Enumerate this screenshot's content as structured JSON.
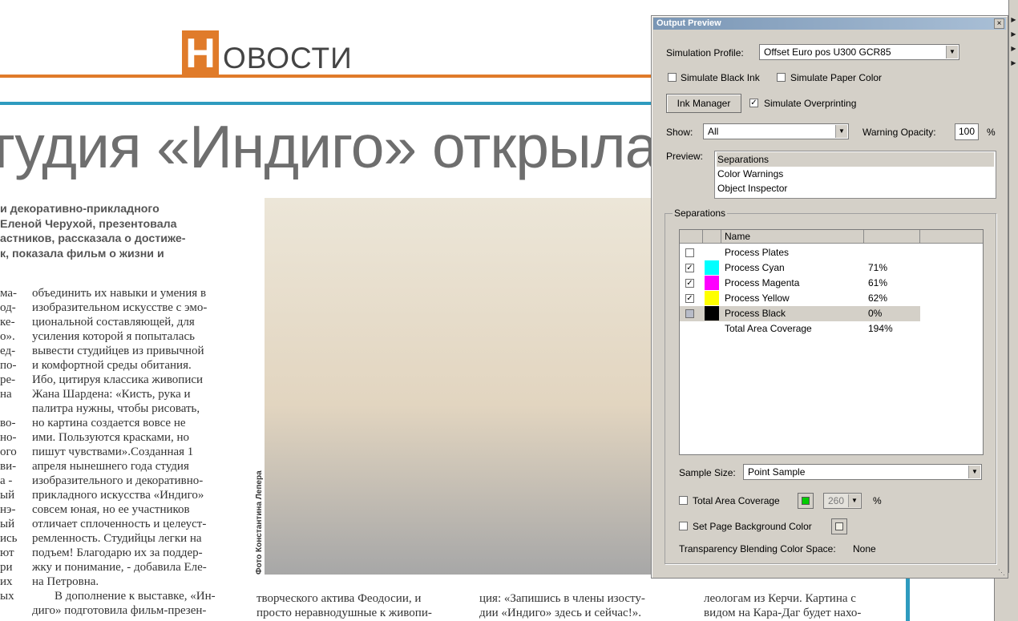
{
  "newspaper": {
    "heading_letter": "Н",
    "heading_rest": "ОВОСТИ",
    "headline": "тудия «Индиго» открыла в",
    "lead_lines": [
      "и декоративно-прикладного",
      "Еленой Черухой, презентовала",
      "астников, рассказала о достиже-",
      "к, показала фильм о жизни и"
    ],
    "col_a_lines": [
      "ма-",
      "од-",
      "ке-",
      "о».",
      "ед-",
      "по-",
      "ре-",
      "на",
      "",
      "во-",
      "но-",
      "ого",
      "ви-",
      "а -",
      "ый",
      "нэ-",
      "ый",
      "ись",
      "ют",
      "ри",
      "их",
      "ых"
    ],
    "col_b_lines": [
      "объединить их навыки и умения в",
      "изобразительном искусстве с эмо-",
      "циональной составляющей, для",
      "усиления которой я попыталась",
      "вывести студийцев из привычной",
      "и комфортной среды обитания.",
      "Ибо, цитируя классика живописи",
      "Жана Шардена: «Кисть, рука и",
      "палитра нужны, чтобы рисовать,",
      "но картина создается вовсе не",
      "ими. Пользуются красками, но",
      "пишут чувствами».Созданная 1",
      "апреля нынешнего года студия",
      "изобразительного и декоративно-",
      "прикладного искусства «Индиго»",
      "совсем юная, но ее участников",
      "отличает сплоченность и целеуст-",
      "ремленность. Студийцы легки на",
      "подъем! Благодарю их за поддер-",
      "жку и понимание, - добавила Еле-",
      "на Петровна.",
      "В дополнение к выставке, «Ин-",
      "диго» подготовила фильм-презен-"
    ],
    "bottom_c": [
      "творческого актива Феодосии, и",
      "просто неравнодушные к живопи-"
    ],
    "bottom_d": [
      "ция: «Запишись в члены изосту-",
      "дии «Индиго» здесь и сейчас!»."
    ],
    "bottom_e": [
      "леологам из Керчи. Картина с",
      "видом на Кара-Даг будет нахо-"
    ],
    "photo_credit": "Фото Константина Лепера"
  },
  "panel": {
    "title": "Output Preview",
    "simulation_profile_label": "Simulation Profile:",
    "simulation_profile_value": "Offset Euro pos U300 GCR85",
    "simulate_black_ink": "Simulate Black Ink",
    "simulate_paper_color": "Simulate Paper Color",
    "ink_manager": "Ink Manager",
    "simulate_overprinting": "Simulate Overprinting",
    "show_label": "Show:",
    "show_value": "All",
    "warning_opacity_label": "Warning Opacity:",
    "warning_opacity_value": "100",
    "percent": "%",
    "preview_label": "Preview:",
    "preview_items": [
      "Separations",
      "Color Warnings",
      "Object Inspector"
    ],
    "separations_group": "Separations",
    "table_header_name": "Name",
    "rows": [
      {
        "name": "Process Plates",
        "pct": "",
        "color": "",
        "checked": false
      },
      {
        "name": "Process Cyan",
        "pct": "71%",
        "color": "#00ffff",
        "checked": true
      },
      {
        "name": "Process Magenta",
        "pct": "61%",
        "color": "#ff00ff",
        "checked": true
      },
      {
        "name": "Process Yellow",
        "pct": "62%",
        "color": "#ffff00",
        "checked": true
      },
      {
        "name": "Process Black",
        "pct": "0%",
        "color": "#000000",
        "checked": false
      },
      {
        "name": "Total Area Coverage",
        "pct": "194%",
        "color": "",
        "checked": false
      }
    ],
    "sample_size_label": "Sample Size:",
    "sample_size_value": "Point Sample",
    "total_area_coverage": "Total Area Coverage",
    "tac_value": "260",
    "set_page_bg": "Set Page Background Color",
    "blend_space_label": "Transparency Blending Color Space:",
    "blend_space_value": "None",
    "tac_color": "#00cc00",
    "page_bg_color": "#f2f0e6"
  }
}
